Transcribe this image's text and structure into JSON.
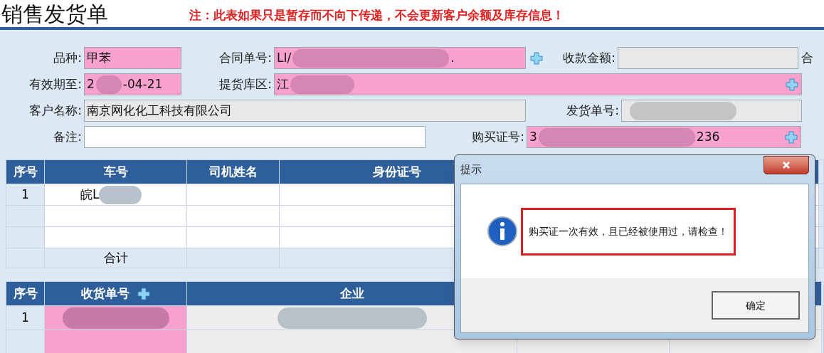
{
  "title": "销售发货单",
  "notice": "注：此表如果只是暂存而不向下传递，不会更新客户余额及库存信息！",
  "form_rows": [
    {
      "fields": [
        {
          "label": "品种:",
          "parts": [
            "甲苯"
          ],
          "kind": "required",
          "redacted": false,
          "add_button": false
        },
        {
          "label": "合同单号:",
          "parts": [
            "LI/",
            "."
          ],
          "kind": "required",
          "redacted": true,
          "add_button": true,
          "add_inside": false
        },
        {
          "label": "收款金额:",
          "kind": "readonly",
          "redacted": false,
          "add_button": false
        },
        {
          "label": "合",
          "kind": "label_only"
        }
      ]
    },
    {
      "fields": [
        {
          "label": "有效期至:",
          "parts": [
            "2",
            "-04-21"
          ],
          "kind": "required",
          "redacted": true,
          "add_button": false
        },
        {
          "label": "提货库区:",
          "parts": [
            "江"
          ],
          "kind": "required",
          "redacted": true,
          "add_button": true,
          "add_inside": true
        }
      ]
    },
    {
      "fields": [
        {
          "label": "客户名称:",
          "parts": [
            "南京网化化工科技有限公司"
          ],
          "kind": "readonly",
          "redacted": false,
          "add_button": false
        },
        {
          "label": "发货单号:",
          "kind": "readonly",
          "redacted": true,
          "add_button": false
        }
      ]
    },
    {
      "fields": [
        {
          "label": "备注:",
          "kind": "input",
          "redacted": false,
          "add_button": false
        },
        {
          "label": "购买证号:",
          "parts": [
            "3",
            "236"
          ],
          "kind": "required",
          "redacted": true,
          "add_button": true,
          "add_inside": true
        }
      ]
    }
  ],
  "vehicle_table": {
    "columns": [
      "序号",
      "车号",
      "司机姓名",
      "身份证号"
    ],
    "rows": [
      {
        "cells": [
          "1",
          "皖L"
        ],
        "redacted": true
      },
      {
        "cells": [],
        "redacted": false
      },
      {
        "cells": [],
        "redacted": false
      }
    ],
    "total_label": "合计"
  },
  "receipt_table": {
    "columns": [
      "序号",
      "收货单号",
      "企业"
    ],
    "rows": [
      {
        "cells": [
          "1"
        ],
        "redacted": true
      },
      {
        "cells": [],
        "redacted": false
      }
    ]
  },
  "dialog": {
    "title": "提示",
    "message": "购买证一次有效，且已经被使用过，请检查！",
    "ok_button": "确定"
  }
}
